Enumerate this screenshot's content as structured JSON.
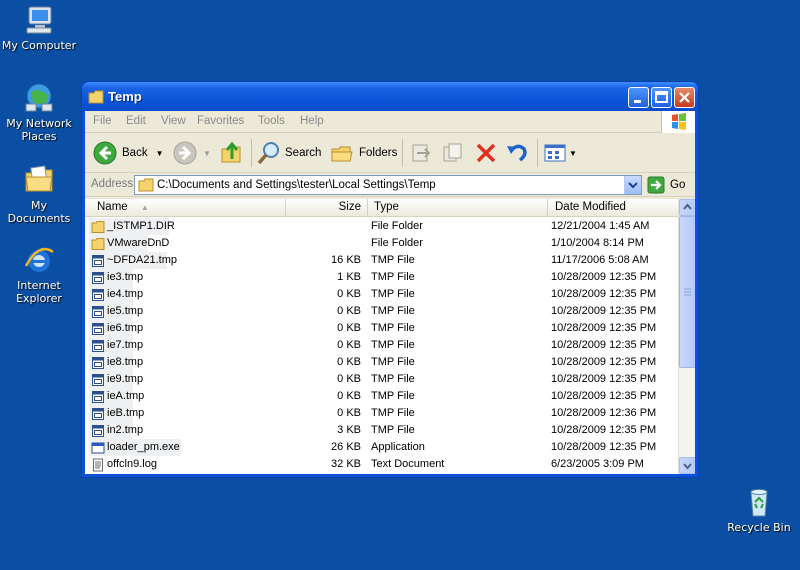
{
  "desktop": {
    "icons": [
      {
        "label": "My Computer"
      },
      {
        "label": "My Network Places"
      },
      {
        "label": "My Documents"
      },
      {
        "label": "Internet Explorer"
      },
      {
        "label": "Recycle Bin"
      }
    ]
  },
  "window": {
    "title": "Temp",
    "menu": [
      "File",
      "Edit",
      "View",
      "Favorites",
      "Tools",
      "Help"
    ],
    "toolbar": {
      "back": "Back",
      "search": "Search",
      "folders": "Folders"
    },
    "address": {
      "label": "Address",
      "value": "C:\\Documents and Settings\\tester\\Local Settings\\Temp",
      "go": "Go"
    },
    "columns": {
      "name": "Name",
      "size": "Size",
      "type": "Type",
      "date": "Date Modified"
    },
    "files": [
      {
        "name": "_ISTMP1.DIR",
        "size": "",
        "type": "File Folder",
        "date": "12/21/2004 1:45 AM",
        "icon": "folder-icon"
      },
      {
        "name": "VMwareDnD",
        "size": "",
        "type": "File Folder",
        "date": "1/10/2004 8:14 PM",
        "icon": "folder-icon"
      },
      {
        "name": "~DFDA21.tmp",
        "size": "16 KB",
        "type": "TMP File",
        "date": "11/17/2006 5:08 AM",
        "icon": "file-icon"
      },
      {
        "name": "ie3.tmp",
        "size": "1 KB",
        "type": "TMP File",
        "date": "10/28/2009 12:35 PM",
        "icon": "file-icon"
      },
      {
        "name": "ie4.tmp",
        "size": "0 KB",
        "type": "TMP File",
        "date": "10/28/2009 12:35 PM",
        "icon": "file-icon"
      },
      {
        "name": "ie5.tmp",
        "size": "0 KB",
        "type": "TMP File",
        "date": "10/28/2009 12:35 PM",
        "icon": "file-icon"
      },
      {
        "name": "ie6.tmp",
        "size": "0 KB",
        "type": "TMP File",
        "date": "10/28/2009 12:35 PM",
        "icon": "file-icon"
      },
      {
        "name": "ie7.tmp",
        "size": "0 KB",
        "type": "TMP File",
        "date": "10/28/2009 12:35 PM",
        "icon": "file-icon"
      },
      {
        "name": "ie8.tmp",
        "size": "0 KB",
        "type": "TMP File",
        "date": "10/28/2009 12:35 PM",
        "icon": "file-icon"
      },
      {
        "name": "ie9.tmp",
        "size": "0 KB",
        "type": "TMP File",
        "date": "10/28/2009 12:35 PM",
        "icon": "file-icon"
      },
      {
        "name": "ieA.tmp",
        "size": "0 KB",
        "type": "TMP File",
        "date": "10/28/2009 12:35 PM",
        "icon": "file-icon"
      },
      {
        "name": "ieB.tmp",
        "size": "0 KB",
        "type": "TMP File",
        "date": "10/28/2009 12:36 PM",
        "icon": "file-icon"
      },
      {
        "name": "in2.tmp",
        "size": "3 KB",
        "type": "TMP File",
        "date": "10/28/2009 12:35 PM",
        "icon": "file-icon"
      },
      {
        "name": "loader_pm.exe",
        "size": "26 KB",
        "type": "Application",
        "date": "10/28/2009 12:35 PM",
        "icon": "application-icon"
      },
      {
        "name": "offcln9.log",
        "size": "32 KB",
        "type": "Text Document",
        "date": "6/23/2005 3:09 PM",
        "icon": "text-document-icon"
      }
    ]
  },
  "colors": {
    "desktop": "#0a4fa3",
    "titlebar": "#0b55d8",
    "window_face": "#ece9d8"
  }
}
